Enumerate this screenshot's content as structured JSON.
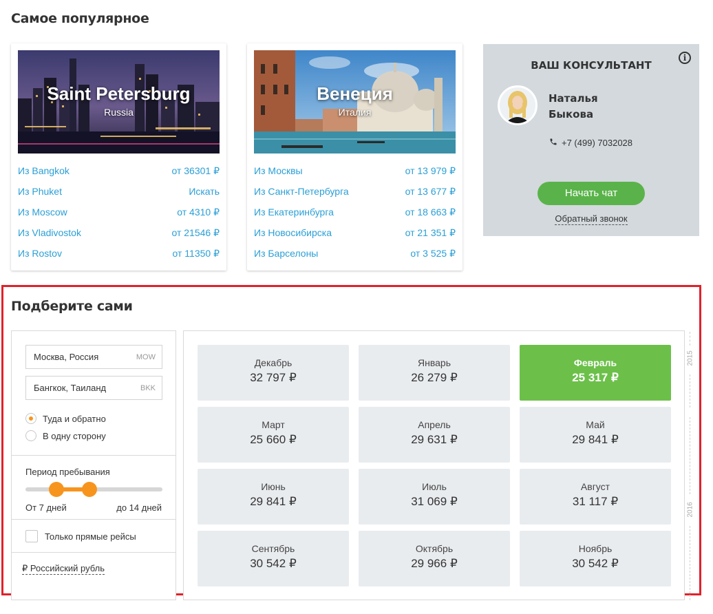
{
  "popular": {
    "title": "Самое популярное",
    "cards": [
      {
        "city": "Saint Petersburg",
        "country": "Russia",
        "routes": [
          {
            "from": "Из Bangkok",
            "price": "от 36301 ₽"
          },
          {
            "from": "Из Phuket",
            "price": "Искать"
          },
          {
            "from": "Из Moscow",
            "price": "от 4310 ₽"
          },
          {
            "from": "Из Vladivostok",
            "price": "от 21546 ₽"
          },
          {
            "from": "Из Rostov",
            "price": "от 11350 ₽"
          }
        ]
      },
      {
        "city": "Венеция",
        "country": "Италия",
        "routes": [
          {
            "from": "Из Москвы",
            "price": "от 13 979 ₽"
          },
          {
            "from": "Из Санкт-Петербурга",
            "price": "от 13 677 ₽"
          },
          {
            "from": "Из Екатеринбурга",
            "price": "от 18 663 ₽"
          },
          {
            "from": "Из Новосибирска",
            "price": "от 21 351 ₽"
          },
          {
            "from": "Из Барселоны",
            "price": "от 3 525 ₽"
          }
        ]
      }
    ]
  },
  "consultant": {
    "title": "ВАШ КОНСУЛЬТАНТ",
    "info_icon": "i",
    "first_name": "Наталья",
    "last_name": "Быкова",
    "phone": "+7 (499) 7032028",
    "chat_button": "Начать чат",
    "callback_link": "Обратный звонок"
  },
  "finder": {
    "title": "Подберите сами",
    "origin": {
      "value": "Москва, Россия",
      "code": "MOW"
    },
    "destination": {
      "value": "Бангкок, Таиланд",
      "code": "BKK"
    },
    "trip_types": [
      {
        "label": "Туда и обратно",
        "selected": true
      },
      {
        "label": "В одну сторону",
        "selected": false
      }
    ],
    "period_label": "Период пребывания",
    "period_min": "От 7 дней",
    "period_max": "до 14 дней",
    "direct_only_label": "Только прямые рейсы",
    "direct_only_checked": false,
    "currency_link": "₽ Российский рубль"
  },
  "months": [
    {
      "name": "Декабрь",
      "price": "32 797 ₽",
      "selected": false
    },
    {
      "name": "Январь",
      "price": "26 279 ₽",
      "selected": false
    },
    {
      "name": "Февраль",
      "price": "25 317 ₽",
      "selected": true
    },
    {
      "name": "Март",
      "price": "25 660 ₽",
      "selected": false
    },
    {
      "name": "Апрель",
      "price": "29 631 ₽",
      "selected": false
    },
    {
      "name": "Май",
      "price": "29 841 ₽",
      "selected": false
    },
    {
      "name": "Июнь",
      "price": "29 841 ₽",
      "selected": false
    },
    {
      "name": "Июль",
      "price": "31 069 ₽",
      "selected": false
    },
    {
      "name": "Август",
      "price": "31 117 ₽",
      "selected": false
    },
    {
      "name": "Сентябрь",
      "price": "30 542 ₽",
      "selected": false
    },
    {
      "name": "Октябрь",
      "price": "29 966 ₽",
      "selected": false
    },
    {
      "name": "Ноябрь",
      "price": "30 542 ₽",
      "selected": false
    }
  ],
  "years": [
    "2015",
    "2016"
  ],
  "colors": {
    "link": "#2a9fd6",
    "accent_orange": "#f7941d",
    "selected_green": "#6cc04a",
    "chat_green": "#5ab34a",
    "highlight_red": "#e0212a"
  }
}
